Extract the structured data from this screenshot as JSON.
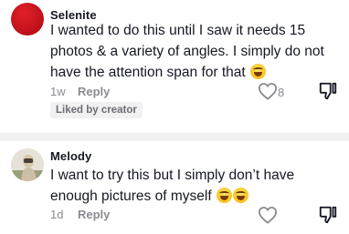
{
  "comments": [
    {
      "username": "Selenite",
      "text": "I wanted to do this until I saw it needs 15 photos & a variety of angles. I simply do not have the attention span for that",
      "emoji_count": 1,
      "time": "1w",
      "reply_label": "Reply",
      "like_count": "8",
      "badge": "Liked by creator",
      "avatar": "red-circle-avatar"
    },
    {
      "username": "Melody",
      "text": "I want to try this but I simply don’t have enough pictures of myself",
      "emoji_count": 2,
      "time": "1d",
      "reply_label": "Reply",
      "avatar": "photo-avatar"
    }
  ],
  "icons": {
    "like": "heart-outline-icon",
    "dislike": "thumbs-down-outline-icon",
    "emoji": "laughing-tears-emoji"
  },
  "colors": {
    "primary_text": "#161823",
    "secondary_text": "#8a8b91",
    "badge_bg": "#f1f1f2",
    "avatar_red": "#c2121b"
  }
}
